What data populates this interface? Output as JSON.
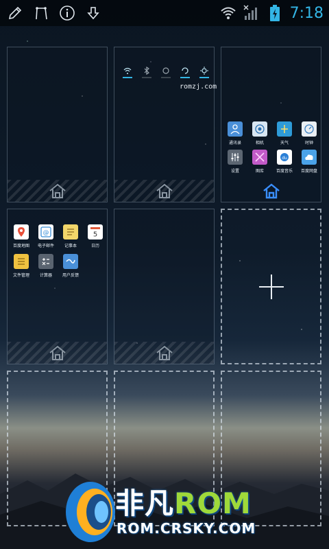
{
  "statusbar": {
    "clock": "7:18",
    "left_icons": [
      "edit-icon",
      "sim-tool-icon",
      "info-icon",
      "download-icon"
    ],
    "right_icons": [
      "wifi-icon",
      "signal-icon",
      "battery-charging-icon"
    ]
  },
  "widget": {
    "watermark": "romzj.com"
  },
  "pages": {
    "p3_apps": [
      {
        "label": "通讯录",
        "icon": "contacts-icon",
        "color": "#4a8fd8"
      },
      {
        "label": "相机",
        "icon": "camera-icon",
        "color": "#d8e6f2"
      },
      {
        "label": "天气",
        "icon": "weather-icon",
        "color": "#2e9bd8"
      },
      {
        "label": "时钟",
        "icon": "clock-icon",
        "color": "#e9eef3"
      },
      {
        "label": "设置",
        "icon": "settings-icon",
        "color": "#5c6672"
      },
      {
        "label": "图库",
        "icon": "gallery-icon",
        "color": "#c25ac8"
      },
      {
        "label": "百度音乐",
        "icon": "music-icon",
        "color": "#ffffff"
      },
      {
        "label": "百度网盘",
        "icon": "cloud-icon",
        "color": "#4aa2e8"
      }
    ],
    "p4_apps": [
      {
        "label": "百度地图",
        "icon": "map-icon",
        "color": "#ffffff"
      },
      {
        "label": "电子邮件",
        "icon": "email-icon",
        "color": "#ffffff"
      },
      {
        "label": "记事本",
        "icon": "notepad-icon",
        "color": "#f2d66a"
      },
      {
        "label": "日历",
        "icon": "calendar-icon",
        "color": "#ffffff"
      },
      {
        "label": "文件管理",
        "icon": "file-manager-icon",
        "color": "#f0c240"
      },
      {
        "label": "计算器",
        "icon": "calculator-icon",
        "color": "#5a6470"
      },
      {
        "label": "用户反馈",
        "icon": "feedback-icon",
        "color": "#4a90d8"
      }
    ],
    "calendar_day": "5"
  },
  "watermark_logo": {
    "line1_a": "非凡",
    "line1_b": "ROM",
    "line2": "ROM.CRSKY.COM"
  },
  "colors": {
    "accent": "#33b5e5",
    "home_active": "#3a8fff",
    "home_inactive": "#8a96a2"
  }
}
